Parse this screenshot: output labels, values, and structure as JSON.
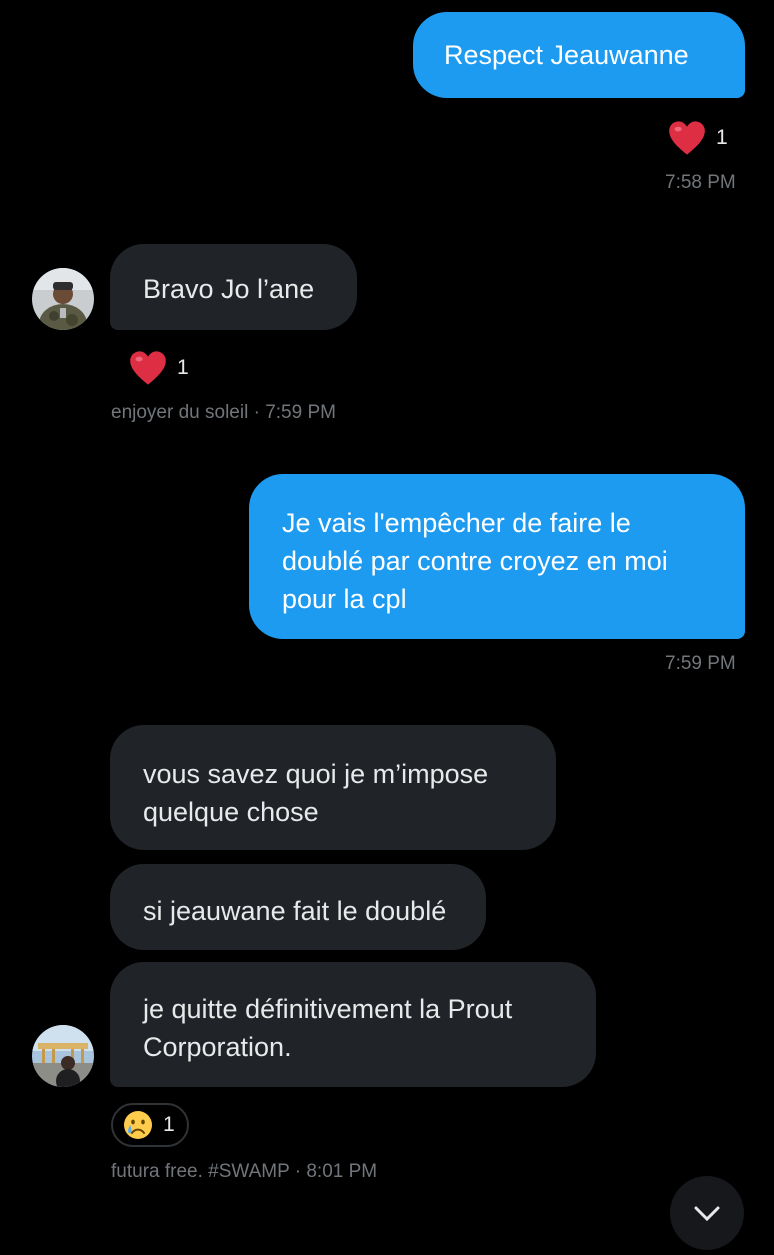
{
  "messages": [
    {
      "text": "Respect Jeauwanne",
      "reaction_count": "1",
      "time": "7:58 PM"
    },
    {
      "text": "Bravo Jo l’ane",
      "reaction_count": "1",
      "meta": "enjoyer du soleil · 7:59 PM"
    },
    {
      "lines": [
        "Je vais l'empêcher de faire le",
        "doublé par contre croyez en moi",
        "pour la cpl"
      ],
      "time": "7:59 PM"
    },
    {
      "lines": [
        "vous savez quoi je m’impose",
        "quelque chose"
      ]
    },
    {
      "text": "si jeauwane fait le doublé"
    },
    {
      "lines": [
        "je quitte définitivement la Prout",
        "Corporation."
      ],
      "reaction_count": "1",
      "meta": "futura free. #SWAMP · 8:01 PM"
    }
  ],
  "icons": {
    "heart": "heart-emoji",
    "crying": "crying-face-emoji",
    "avatar1": "user-avatar",
    "avatar2": "user-avatar"
  },
  "colors": {
    "background": "#000000",
    "outgoing_bubble": "#1d9bf0",
    "incoming_bubble": "#202327",
    "meta_text": "#71767b"
  }
}
